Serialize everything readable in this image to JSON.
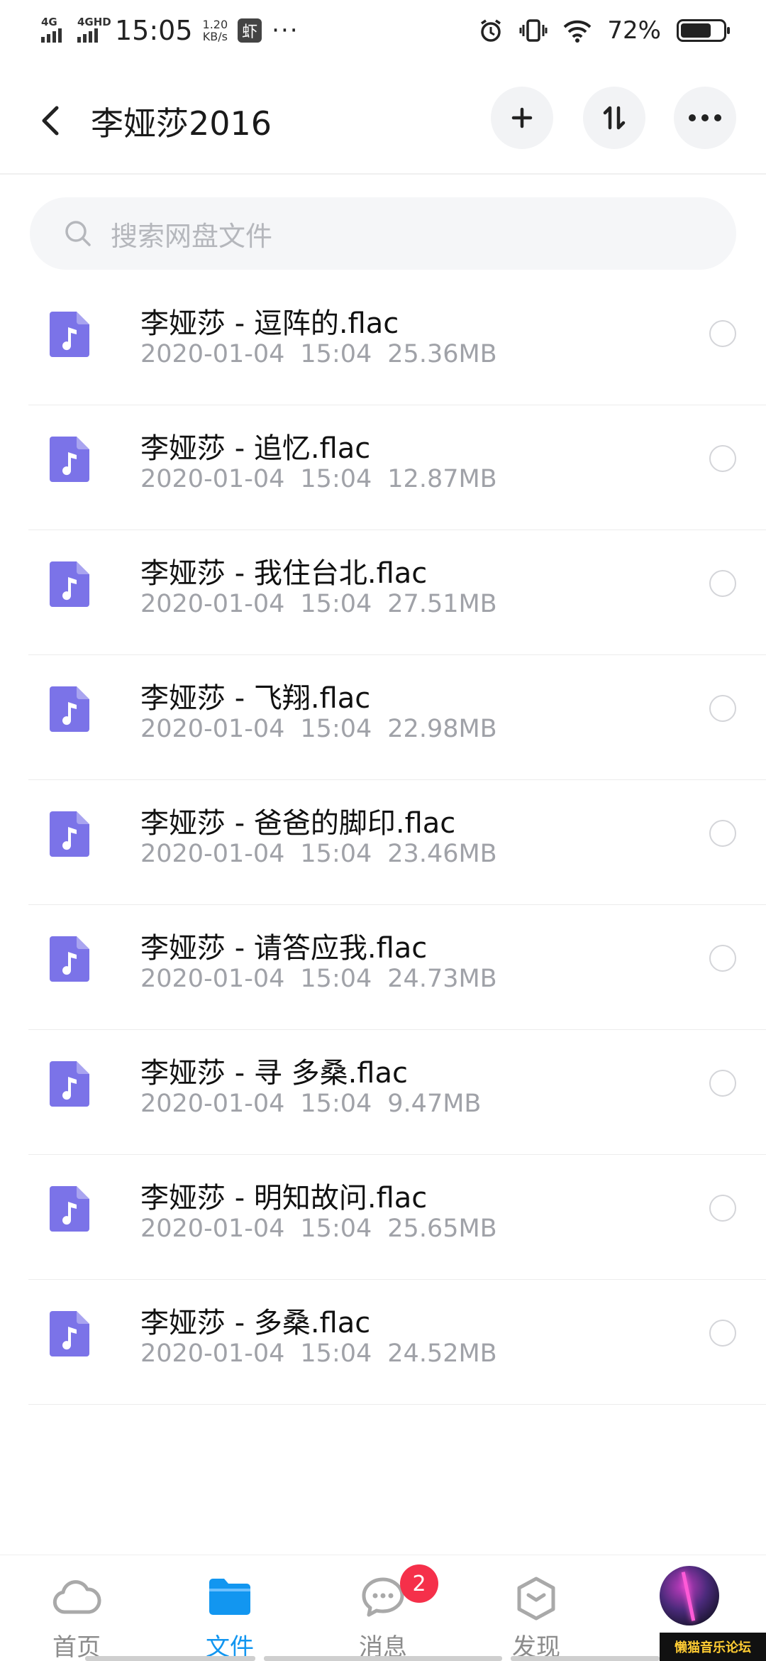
{
  "status_bar": {
    "signal1": "4G",
    "signal2": "4GHD",
    "time": "15:05",
    "speed_value": "1.20",
    "speed_unit": "KB/s",
    "app_glyph": "虾",
    "more": "···",
    "battery_text": "72%",
    "battery_level": 0.72
  },
  "header": {
    "title": "李娅莎2016"
  },
  "search": {
    "placeholder": "搜索网盘文件"
  },
  "files": [
    {
      "name": "李娅莎 - 逗阵的.flac",
      "date": "2020-01-04",
      "time": "15:04",
      "size": "25.36MB"
    },
    {
      "name": "李娅莎 - 追忆.flac",
      "date": "2020-01-04",
      "time": "15:04",
      "size": "12.87MB"
    },
    {
      "name": "李娅莎 - 我住台北.flac",
      "date": "2020-01-04",
      "time": "15:04",
      "size": "27.51MB"
    },
    {
      "name": "李娅莎 - 飞翔.flac",
      "date": "2020-01-04",
      "time": "15:04",
      "size": "22.98MB"
    },
    {
      "name": "李娅莎 - 爸爸的脚印.flac",
      "date": "2020-01-04",
      "time": "15:04",
      "size": "23.46MB"
    },
    {
      "name": "李娅莎 - 请答应我.flac",
      "date": "2020-01-04",
      "time": "15:04",
      "size": "24.73MB"
    },
    {
      "name": "李娅莎 - 寻 多桑.flac",
      "date": "2020-01-04",
      "time": "15:04",
      "size": "9.47MB"
    },
    {
      "name": "李娅莎 - 明知故问.flac",
      "date": "2020-01-04",
      "time": "15:04",
      "size": "25.65MB"
    },
    {
      "name": "李娅莎 - 多桑.flac",
      "date": "2020-01-04",
      "time": "15:04",
      "size": "24.52MB"
    }
  ],
  "nav": {
    "home": "首页",
    "files": "文件",
    "messages": "消息",
    "discover": "发现",
    "messages_badge": "2"
  },
  "colors": {
    "accent": "#1296f0",
    "file_icon": "#7b73e8",
    "badge": "#f5304a"
  },
  "watermark": "懒猫音乐论坛"
}
